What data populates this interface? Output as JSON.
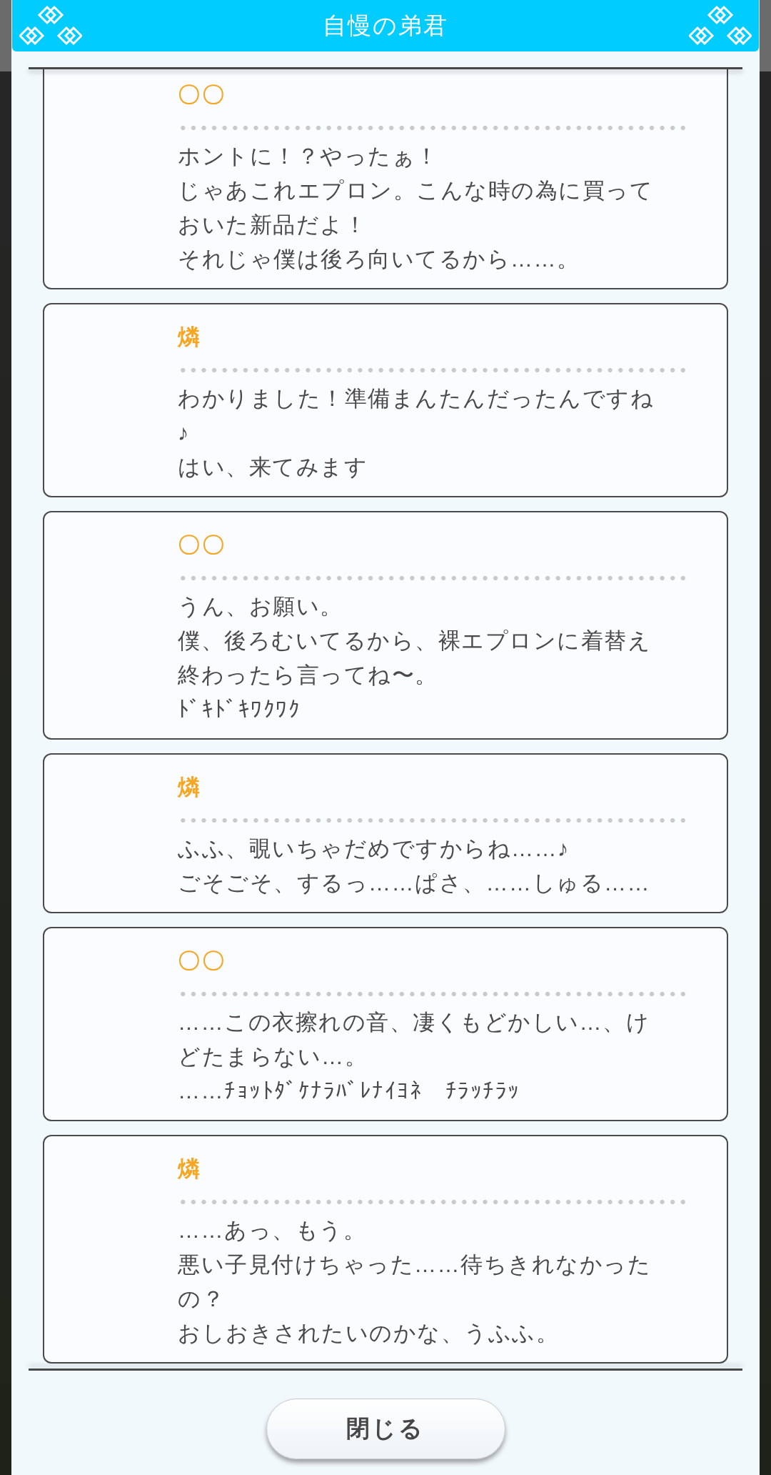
{
  "header": {
    "title": "自慢の弟君"
  },
  "messages": [
    {
      "speaker": "〇〇",
      "lines": [
        "ホントに！？やったぁ！",
        "じゃあこれエプロン。こんな時の為に買っておいた新品だよ！",
        "それじゃ僕は後ろ向いてるから……。"
      ]
    },
    {
      "speaker": "燐",
      "lines": [
        "わかりました！準備まんたんだったんですね♪",
        "はい、来てみます"
      ]
    },
    {
      "speaker": "〇〇",
      "lines": [
        "うん、お願い。",
        "僕、後ろむいてるから、裸エプロンに着替え終わったら言ってね〜。",
        "ﾄﾞｷﾄﾞｷﾜｸﾜｸ"
      ]
    },
    {
      "speaker": "燐",
      "lines": [
        "ふふ、覗いちゃだめですからね……♪",
        "ごそごそ、するっ……ぱさ、……しゅる……"
      ]
    },
    {
      "speaker": "〇〇",
      "lines": [
        "……この衣擦れの音、凄くもどかしい…、けどたまらない…。",
        "……ﾁｮｯﾄﾀﾞｹﾅﾗﾊﾞﾚﾅｲﾖﾈ　ﾁﾗｯﾁﾗｯ"
      ]
    },
    {
      "speaker": "燐",
      "lines": [
        "……あっ、もう。",
        "悪い子見付けちゃった……待ちきれなかったの？",
        "おしおきされたいのかな、うふふ。"
      ]
    }
  ],
  "close_button": {
    "label": "閉じる"
  }
}
